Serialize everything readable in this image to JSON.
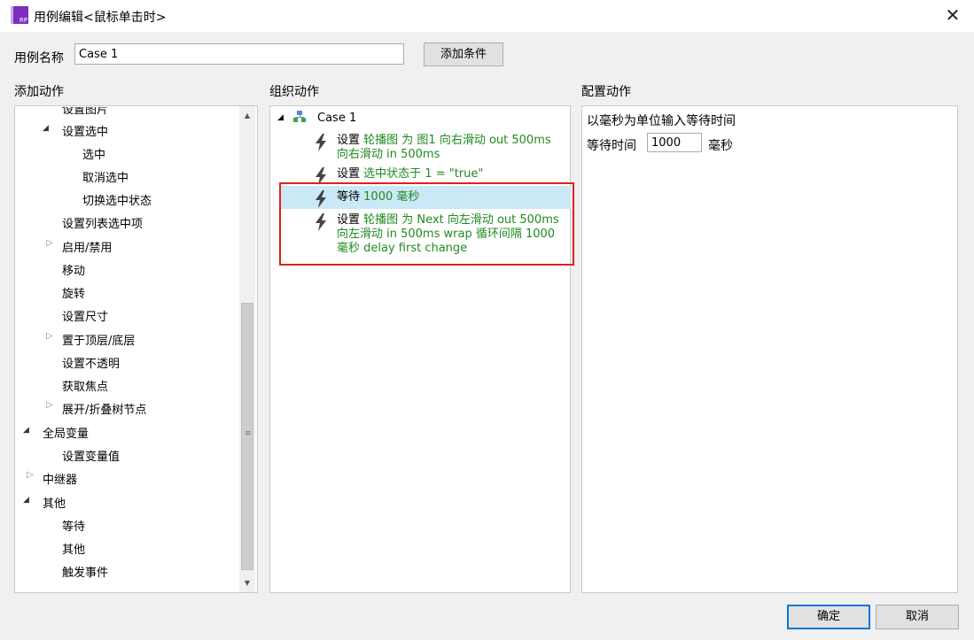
{
  "window": {
    "title": "用例编辑<鼠标单击时>",
    "icon_text": "RP"
  },
  "case_name": {
    "label": "用例名称",
    "value": "Case 1"
  },
  "add_condition_button": "添加条件",
  "left_panel": {
    "header": "添加动作",
    "items": [
      {
        "label": "设置图片",
        "expand": "none"
      },
      {
        "label": "设置选中",
        "expand": "open"
      },
      {
        "label": "选中",
        "expand": "none"
      },
      {
        "label": "取消选中",
        "expand": "none"
      },
      {
        "label": "切换选中状态",
        "expand": "none"
      },
      {
        "label": "设置列表选中项",
        "expand": "none"
      },
      {
        "label": "启用/禁用",
        "expand": "closed"
      },
      {
        "label": "移动",
        "expand": "none"
      },
      {
        "label": "旋转",
        "expand": "none"
      },
      {
        "label": "设置尺寸",
        "expand": "none"
      },
      {
        "label": "置于顶层/底层",
        "expand": "closed"
      },
      {
        "label": "设置不透明",
        "expand": "none"
      },
      {
        "label": "获取焦点",
        "expand": "none"
      },
      {
        "label": "展开/折叠树节点",
        "expand": "closed"
      },
      {
        "label": "全局变量",
        "expand": "open"
      },
      {
        "label": "设置变量值",
        "expand": "none"
      },
      {
        "label": "中继器",
        "expand": "closed"
      },
      {
        "label": "其他",
        "expand": "open"
      },
      {
        "label": "等待",
        "expand": "none"
      },
      {
        "label": "其他",
        "expand": "none"
      },
      {
        "label": "触发事件",
        "expand": "none"
      }
    ]
  },
  "middle_panel": {
    "header": "组织动作",
    "case_label": "Case 1",
    "actions": [
      {
        "prefix": "设置",
        "detail": "轮播图 为 图1 向右滑动 out 500ms 向右滑动 in 500ms"
      },
      {
        "prefix": "设置",
        "detail": "选中状态于 1 = \"true\""
      },
      {
        "prefix": "等待",
        "detail": "1000 毫秒"
      },
      {
        "prefix": "设置",
        "detail": "轮播图 为 Next 向左滑动 out 500ms 向左滑动 in 500ms wrap 循环间隔 1000 毫秒 delay first change"
      }
    ]
  },
  "right_panel": {
    "header": "配置动作",
    "description": "以毫秒为单位输入等待时间",
    "wait_label": "等待时间",
    "wait_value": "1000",
    "unit": "毫秒"
  },
  "footer": {
    "ok": "确定",
    "cancel": "取消"
  },
  "colors": {
    "accent": "#0078d7",
    "action_detail": "#1f8a1f",
    "highlight_box": "#e02020",
    "selected_row": "#cbe8f6",
    "app_icon": "#7b2fbe"
  }
}
